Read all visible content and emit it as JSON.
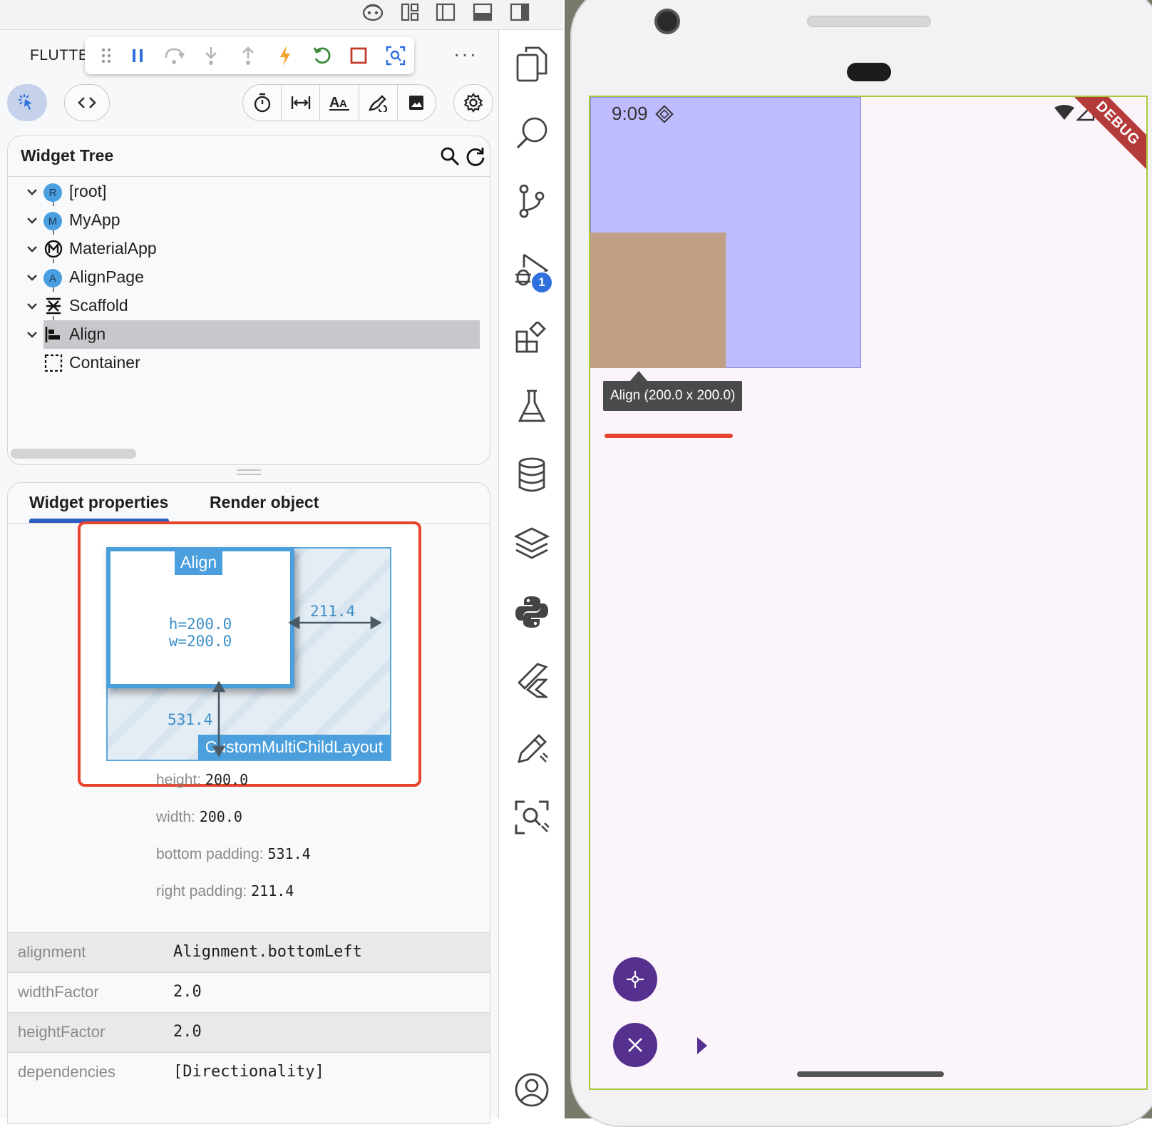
{
  "toolbar": {
    "app_title": "FLUTTE",
    "more": "···",
    "debug_buttons": [
      "drag-handle",
      "pause",
      "step-over",
      "step-into",
      "step-out",
      "hot-reload",
      "hot-restart",
      "stop",
      "inspect-widget"
    ]
  },
  "inspector_controls": {
    "options": [
      "slow-animations",
      "show-guidelines",
      "show-baselines",
      "highlight-repaints",
      "highlight-oversized-images"
    ]
  },
  "widget_tree": {
    "title": "Widget Tree",
    "nodes": [
      {
        "badge": "R",
        "label": "[root]"
      },
      {
        "badge": "M",
        "label": "MyApp"
      },
      {
        "badge": "M",
        "label": "MaterialApp"
      },
      {
        "badge": "A",
        "label": "AlignPage"
      },
      {
        "badge": "",
        "label": "Scaffold"
      },
      {
        "badge": "",
        "label": "Align"
      },
      {
        "badge": "",
        "label": "Container"
      }
    ],
    "selected": "Align"
  },
  "properties": {
    "tabs": [
      "Widget properties",
      "Render object"
    ],
    "active_tab": "Widget properties",
    "layout_explorer": {
      "child_name": "Align",
      "child_h": "h=200.0",
      "child_w": "w=200.0",
      "parent_name": "CustomMultiChildLayout",
      "right_padding_value": "211.4",
      "bottom_padding_value": "531.4"
    },
    "summary": [
      {
        "key": "height:",
        "value": "200.0"
      },
      {
        "key": "width:",
        "value": "200.0"
      },
      {
        "key": "bottom padding:",
        "value": "531.4"
      },
      {
        "key": "right padding:",
        "value": "211.4"
      }
    ],
    "table": [
      {
        "name": "alignment",
        "value": "Alignment.bottomLeft"
      },
      {
        "name": "widthFactor",
        "value": "2.0"
      },
      {
        "name": "heightFactor",
        "value": "2.0"
      },
      {
        "name": "dependencies",
        "value": "[Directionality]"
      }
    ]
  },
  "activity_bar": {
    "items": [
      "explorer",
      "search",
      "source-control",
      "run-and-debug",
      "extensions",
      "testing",
      "database",
      "layers",
      "python",
      "flutter",
      "edit",
      "scan",
      "account"
    ],
    "debug_badge": "1"
  },
  "phone": {
    "status_time": "9:09",
    "debug_banner": "DEBUG",
    "overlay_tooltip": "Align (200.0 x 200.0)",
    "colors": {
      "align_area": "#bebcff",
      "container": "#bf9f85",
      "screen_bg": "#fcf4fb",
      "fab": "#55308f",
      "banner": "#b53b3b"
    }
  }
}
